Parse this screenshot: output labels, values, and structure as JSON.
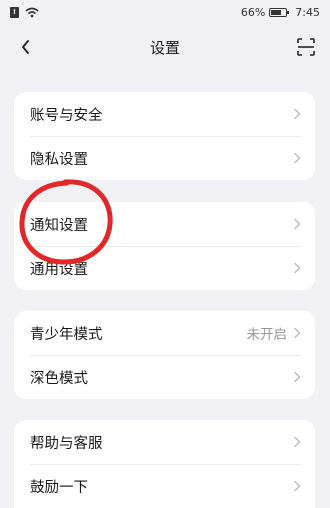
{
  "status_bar": {
    "sim_label": "!",
    "battery": "66%",
    "time": "7:45"
  },
  "nav": {
    "title": "设置",
    "back_icon": "chevron-left-icon",
    "scan_icon": "scan-icon"
  },
  "groups": [
    {
      "items": [
        {
          "label": "账号与安全"
        },
        {
          "label": "隐私设置"
        }
      ]
    },
    {
      "items": [
        {
          "label": "通知设置"
        },
        {
          "label": "通用设置"
        }
      ]
    },
    {
      "items": [
        {
          "label": "青少年模式",
          "value": "未开启"
        },
        {
          "label": "深色模式"
        }
      ]
    },
    {
      "items": [
        {
          "label": "帮助与客服"
        },
        {
          "label": "鼓励一下"
        }
      ]
    }
  ],
  "annotation": {
    "color": "#e0282a"
  }
}
